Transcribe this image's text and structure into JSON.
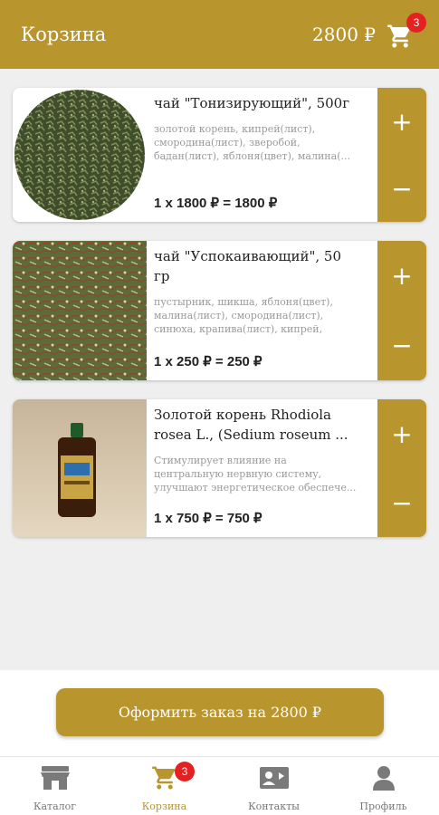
{
  "header": {
    "title": "Корзина",
    "total": "2800 ₽",
    "cart_badge": "3",
    "cart_icon": "cart-icon"
  },
  "items": [
    {
      "title": "чай \"Тонизирующий\", 500г",
      "description": "золотой корень, кипрей(лист),\nсмородина(лист), зверобой,\nбадан(лист), яблоня(цвет), малина(...",
      "price_line": "1 x 1800 ₽ = 1800 ₽",
      "plus": "+",
      "minus": "−"
    },
    {
      "title": "чай \"Успокаивающий\", 50\nгр",
      "description": "пустырник, шикша, яблоня(цвет),\nмалина(лист), смородина(лист),\nсинюха, крапива(лист), кипрей,",
      "price_line": "1 x 250 ₽ = 250 ₽",
      "plus": "+",
      "minus": "−"
    },
    {
      "title": "Золотой корень Rhodiola\nrosea L., (Sedium roseum ...",
      "description": "Стимулирует влияние на\nцентральную нервную систему,\nулучшают энергетическое обеспече...",
      "price_line": "1 x 750 ₽ = 750 ₽",
      "plus": "+",
      "minus": "−"
    }
  ],
  "checkout": {
    "label": "Оформить заказ на 2800 ₽"
  },
  "nav": [
    {
      "label": "Каталог",
      "icon": "store-icon"
    },
    {
      "label": "Корзина",
      "icon": "cart-icon",
      "badge": "3",
      "active": true
    },
    {
      "label": "Контакты",
      "icon": "contact-card-icon"
    },
    {
      "label": "Профиль",
      "icon": "person-icon"
    }
  ],
  "colors": {
    "accent": "#b8952d",
    "badge": "#e52020",
    "background": "#efefef"
  }
}
